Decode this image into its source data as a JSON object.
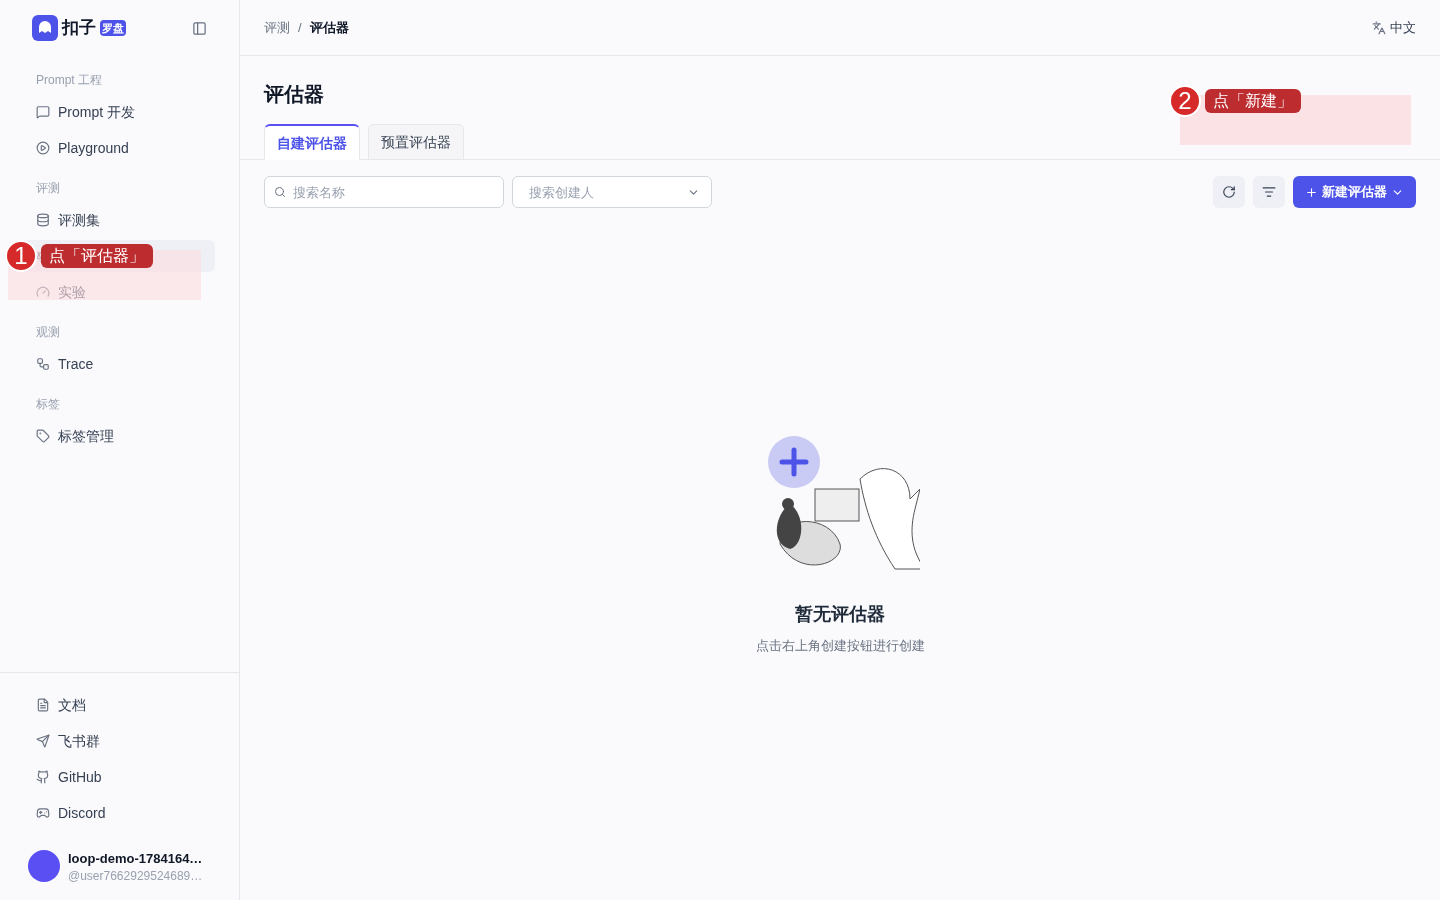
{
  "brand": {
    "name": "扣子",
    "badge": "罗盘"
  },
  "sidebar": {
    "groups": [
      {
        "title": "Prompt 工程",
        "items": [
          {
            "label": "Prompt 开发",
            "selected": false
          },
          {
            "label": "Playground",
            "selected": false
          }
        ]
      },
      {
        "title": "评测",
        "items": [
          {
            "label": "评测集",
            "selected": false
          },
          {
            "selected": true
          },
          {
            "label": "实验",
            "selected": false
          }
        ]
      },
      {
        "title": "观测",
        "items": [
          {
            "label": "Trace",
            "selected": false
          }
        ]
      },
      {
        "title": "标签",
        "items": [
          {
            "label": "标签管理",
            "selected": false
          }
        ]
      }
    ],
    "footer_links": [
      {
        "label": "文档"
      },
      {
        "label": "飞书群"
      },
      {
        "label": "GitHub"
      },
      {
        "label": "Discord"
      }
    ],
    "user": {
      "name": "loop-demo-1784164…",
      "handle": "@user7662929524689…"
    }
  },
  "breadcrumb": {
    "items": [
      "评测",
      "评估器"
    ],
    "separator": "/"
  },
  "language": "中文",
  "page_title": "评估器",
  "tabs": [
    {
      "label": "自建评估器",
      "selected": true
    },
    {
      "label": "预置评估器",
      "selected": false
    }
  ],
  "search": {
    "placeholder": "搜索名称"
  },
  "creator_filter": {
    "placeholder": "搜索创建人"
  },
  "create_button": "新建评估器",
  "empty_state": {
    "title": "暂无评估器",
    "hint": "点击右上角创建按钮进行创建"
  },
  "annotations": [
    {
      "number": "1",
      "text": "点「评估器」"
    },
    {
      "number": "2",
      "text": "点「新建」"
    }
  ]
}
